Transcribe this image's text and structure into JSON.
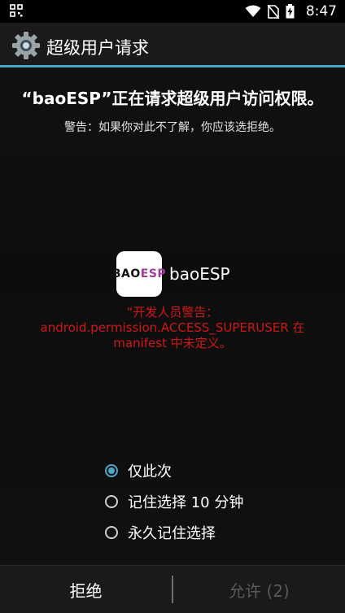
{
  "status": {
    "time": "8:47"
  },
  "titlebar": {
    "title": "超级用户请求"
  },
  "request": {
    "headline": "“baoESP”正在请求超级用户访问权限。",
    "warning": "警告：如果你对此不了解，你应该选拒绝。"
  },
  "app": {
    "icon_text_a": "BAO",
    "icon_text_b": "ESP",
    "name": "baoESP",
    "dev_warning": [
      "“开发人员警告：",
      "android.permission.ACCESS_SUPERUSER 在",
      "manifest 中未定义。"
    ]
  },
  "options": [
    {
      "label": "仅此次",
      "selected": true
    },
    {
      "label": "记住选择 10 分钟",
      "selected": false
    },
    {
      "label": "永久记住选择",
      "selected": false
    }
  ],
  "buttons": {
    "deny": "拒绝",
    "allow": "允许 (2)"
  },
  "colors": {
    "accent": "#4aa9c9",
    "warning": "#d01818"
  }
}
